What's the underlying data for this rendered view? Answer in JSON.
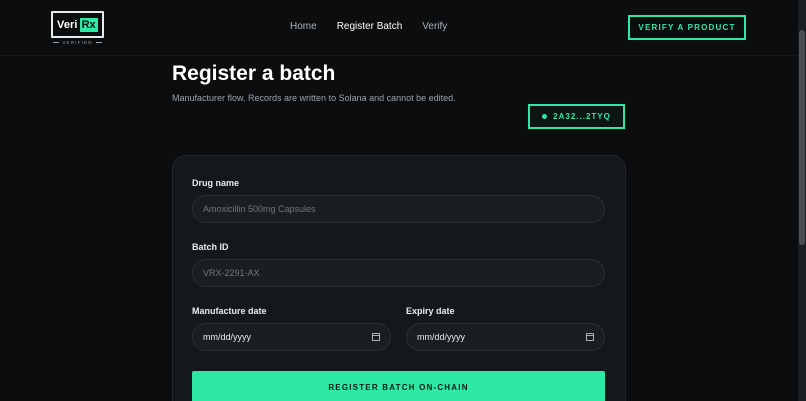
{
  "brand": {
    "name_left": "Veri",
    "name_right": "Rx",
    "tagline": "VERIFIED"
  },
  "nav": [
    {
      "label": "Home"
    },
    {
      "label": "Register Batch"
    },
    {
      "label": "Verify"
    }
  ],
  "header_cta": "VERIFY A PRODUCT",
  "page": {
    "title": "Register a batch",
    "subtitle": "Manufacturer flow. Records are written to Solana and cannot be edited."
  },
  "wallet": {
    "address": "2A32...2TYQ"
  },
  "form": {
    "drug_name": {
      "label": "Drug name",
      "placeholder": "Amoxicillin 500mg Capsules",
      "value": ""
    },
    "batch_id": {
      "label": "Batch ID",
      "placeholder": "VRX-2291-AX",
      "value": ""
    },
    "manufacture_date": {
      "label": "Manufacture date",
      "value": "mm/dd/yyyy"
    },
    "expiry_date": {
      "label": "Expiry date",
      "value": "mm/dd/yyyy"
    },
    "submit_label": "REGISTER BATCH ON-CHAIN"
  },
  "colors": {
    "accent": "#2ee8a6",
    "background": "#0b0d0f",
    "card": "#15181b"
  }
}
